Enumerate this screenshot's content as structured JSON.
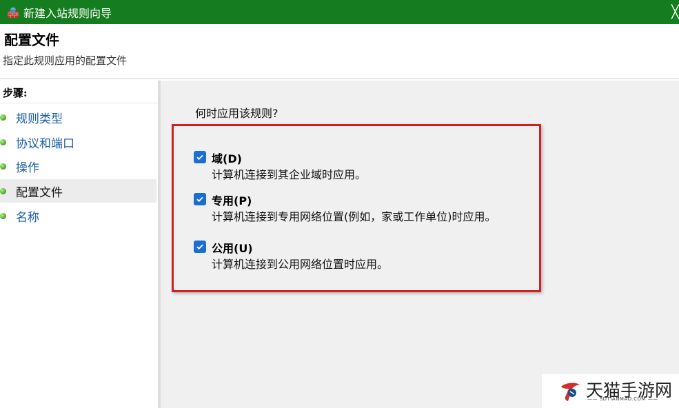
{
  "window": {
    "title": "新建入站规则向导",
    "icon": "firewall-icon",
    "close_glyph": "╳"
  },
  "header": {
    "title": "配置文件",
    "subtitle": "指定此规则应用的配置文件"
  },
  "sidebar": {
    "steps_label": "步骤:",
    "items": [
      {
        "label": "规则类型",
        "current": false
      },
      {
        "label": "协议和端口",
        "current": false
      },
      {
        "label": "操作",
        "current": false
      },
      {
        "label": "配置文件",
        "current": true
      },
      {
        "label": "名称",
        "current": false
      }
    ]
  },
  "main": {
    "question": "何时应用该规则?",
    "options": [
      {
        "title": "域(D)",
        "description": "计算机连接到其企业域时应用。",
        "checked": true
      },
      {
        "title": "专用(P)",
        "description": "计算机连接到专用网络位置(例如，家或工作单位)时应用。",
        "checked": true
      },
      {
        "title": "公用(U)",
        "description": "计算机连接到公用网络位置时应用。",
        "checked": true
      }
    ]
  },
  "watermark": {
    "name": "天猫手游网",
    "domain": "—— SDTIANMAO.COM ——"
  },
  "colors": {
    "titlebar": "#157c1f",
    "highlight": "#d21f1f",
    "checkbox": "#1c6fd1",
    "link": "#1a5ea8"
  }
}
